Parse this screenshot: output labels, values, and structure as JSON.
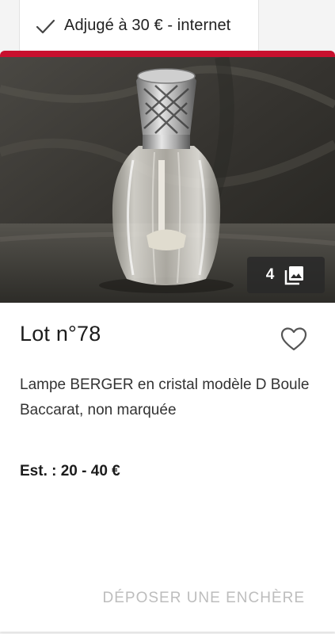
{
  "status": {
    "sold_label": "Adjugé à 30 € - internet",
    "icon": "check-icon"
  },
  "photo": {
    "alt": "Lampe BERGER en cristal",
    "image_count": "4",
    "count_icon": "gallery-icon"
  },
  "lot": {
    "title": "Lot n°78",
    "description": "Lampe BERGER en cristal modèle D Boule Baccarat, non marquée",
    "estimate": "Est. : 20 - 40 €",
    "favorite_icon": "heart-outline-icon"
  },
  "actions": {
    "bid_label": "DÉPOSER UNE ENCHÈRE"
  },
  "colors": {
    "accent": "#c8102e",
    "disabled_text": "#bdbdbd"
  }
}
